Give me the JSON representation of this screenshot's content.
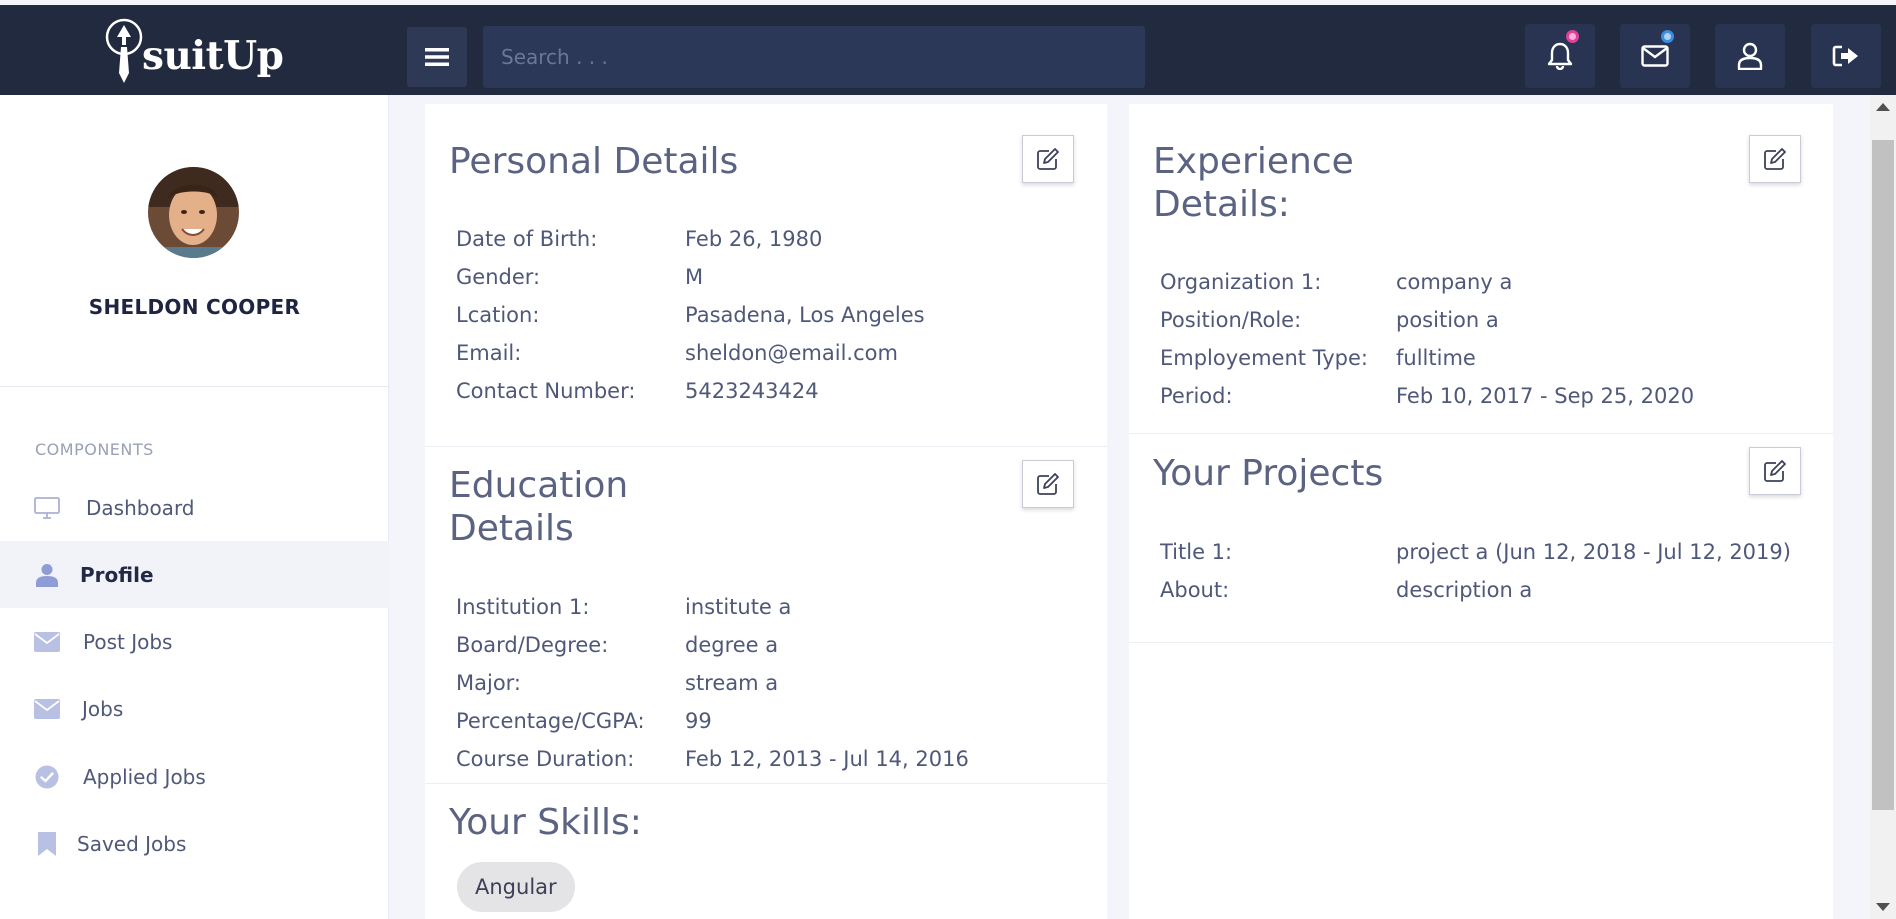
{
  "header": {
    "logo_text": "suitUp",
    "search_placeholder": "Search . . .",
    "notification_dot_color": "#e0409a",
    "message_dot_color": "#3b8de0"
  },
  "sidebar": {
    "user_name": "SHELDON COOPER",
    "section_label": "COMPONENTS",
    "items": [
      {
        "label": "Dashboard",
        "icon": "monitor-icon"
      },
      {
        "label": "Profile",
        "icon": "user-icon",
        "active": true
      },
      {
        "label": "Post Jobs",
        "icon": "envelope-icon"
      },
      {
        "label": "Jobs",
        "icon": "envelope-icon"
      },
      {
        "label": "Applied Jobs",
        "icon": "check-circle-icon"
      },
      {
        "label": "Saved Jobs",
        "icon": "bookmark-icon"
      }
    ]
  },
  "personal": {
    "title": "Personal Details",
    "rows": [
      {
        "label": "Date of Birth:",
        "value": "Feb 26, 1980"
      },
      {
        "label": "Gender:",
        "value": "M"
      },
      {
        "label": "Lcation:",
        "value": "Pasadena, Los Angeles"
      },
      {
        "label": "Email:",
        "value": "sheldon@email.com"
      },
      {
        "label": "Contact Number:",
        "value": "5423243424"
      }
    ]
  },
  "education": {
    "title_line1": "Education",
    "title_line2": "Details",
    "rows": [
      {
        "label": "Institution 1:",
        "value": "institute a"
      },
      {
        "label": "Board/Degree:",
        "value": "degree a"
      },
      {
        "label": "Major:",
        "value": "stream a"
      },
      {
        "label": "Percentage/CGPA:",
        "value": "99"
      },
      {
        "label": "Course Duration:",
        "value": "Feb 12, 2013 - Jul 14, 2016"
      }
    ]
  },
  "skills": {
    "title": "Your Skills:",
    "items": [
      "Angular"
    ]
  },
  "experience": {
    "title_line1": "Experience",
    "title_line2": "Details:",
    "rows": [
      {
        "label": "Organization 1:",
        "value": "company a"
      },
      {
        "label": "Position/Role:",
        "value": "position a"
      },
      {
        "label": "Employement Type:",
        "value": "fulltime"
      },
      {
        "label": "Period:",
        "value": "Feb 10, 2017 - Sep 25, 2020"
      }
    ]
  },
  "projects": {
    "title": "Your Projects",
    "rows": [
      {
        "label": "Title 1:",
        "value": "project a (Jun 12, 2018 - Jul 12, 2019)"
      },
      {
        "label": "About:",
        "value": "description a"
      }
    ]
  }
}
